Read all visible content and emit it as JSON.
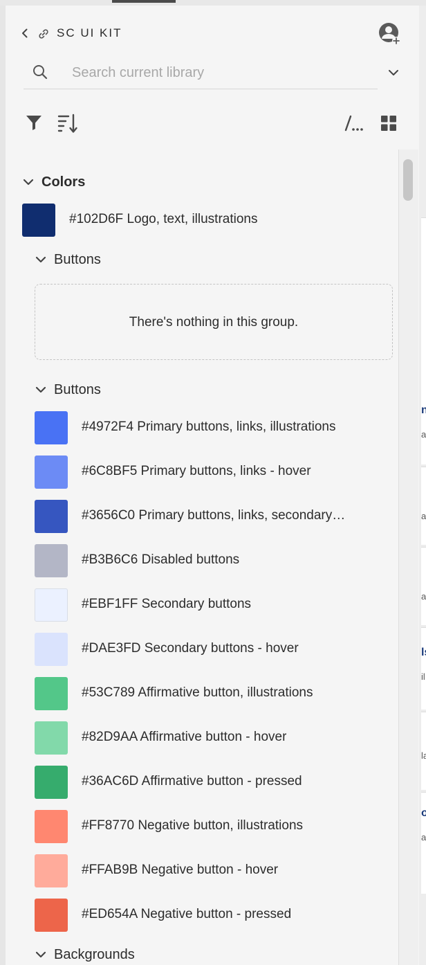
{
  "library": {
    "title": "SC UI KIT"
  },
  "search": {
    "placeholder": "Search current library",
    "value": ""
  },
  "toolbar": {
    "path_label": "/..."
  },
  "groups": {
    "colors": {
      "label": "Colors"
    },
    "top_color": {
      "hex": "#102D6F",
      "label": "#102D6F Logo, text, illustrations"
    },
    "buttons_empty": {
      "label": "Buttons",
      "empty_message": "There's nothing in this group."
    },
    "buttons": {
      "label": "Buttons",
      "items": [
        {
          "hex": "#4972F4",
          "label": "#4972F4 Primary buttons, links, illustrations"
        },
        {
          "hex": "#6C8BF5",
          "label": "#6C8BF5 Primary buttons, links - hover"
        },
        {
          "hex": "#3656C0",
          "label": "#3656C0 Primary buttons, links, secondary…"
        },
        {
          "hex": "#B3B6C6",
          "label": "#B3B6C6 Disabled buttons"
        },
        {
          "hex": "#EBF1FF",
          "label": "#EBF1FF Secondary buttons"
        },
        {
          "hex": "#DAE3FD",
          "label": "#DAE3FD Secondary buttons - hover"
        },
        {
          "hex": "#53C789",
          "label": "#53C789 Affirmative button, illustrations"
        },
        {
          "hex": "#82D9AA",
          "label": "#82D9AA Affirmative button - hover"
        },
        {
          "hex": "#36AC6D",
          "label": "#36AC6D Affirmative button - pressed"
        },
        {
          "hex": "#FF8770",
          "label": "#FF8770 Negative button, illustrations"
        },
        {
          "hex": "#FFAB9B",
          "label": "#FFAB9B Negative button - hover"
        },
        {
          "hex": "#ED654A",
          "label": "#ED654A Negative button - pressed"
        }
      ]
    },
    "backgrounds": {
      "label": "Backgrounds"
    }
  },
  "right_pane_fragments": [
    "n",
    "a",
    "a",
    "a",
    "ls",
    "il",
    "la",
    "o",
    "a"
  ]
}
